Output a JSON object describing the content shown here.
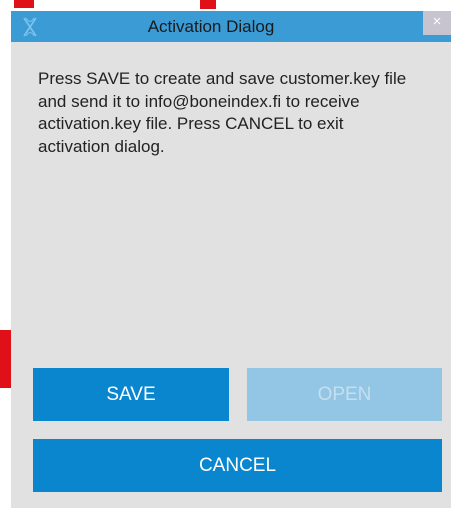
{
  "window": {
    "title": "Activation Dialog",
    "close_label": "×"
  },
  "message": "Press SAVE to create and save customer.key file and send it to info@boneindex.fi to receive activation.key file. Press CANCEL to exit activation dialog.",
  "buttons": {
    "save_label": "SAVE",
    "open_label": "OPEN",
    "open_enabled": false,
    "cancel_label": "CANCEL"
  },
  "colors": {
    "titlebar": "#3a9bd5",
    "button_primary": "#0a86cf",
    "button_disabled": "#93c6e4",
    "dialog_bg": "#e1e1e1"
  }
}
